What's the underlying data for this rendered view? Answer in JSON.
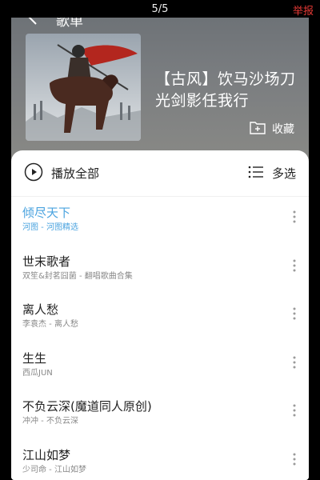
{
  "viewer": {
    "counter": "5/5",
    "report": "举报"
  },
  "header": {
    "title": "歌单",
    "back_icon": "back-arrow-icon"
  },
  "album": {
    "title_line1": "【古风】饮马沙场刀",
    "title_line2": "光剑影任我行",
    "collect_label": "收藏",
    "collect_icon": "add-folder-icon"
  },
  "toolbar": {
    "play_all_label": "播放全部",
    "play_icon": "play-circle-icon",
    "multi_select_label": "多选",
    "multi_select_icon": "list-icon"
  },
  "songs": [
    {
      "title": "倾尽天下",
      "subtitle": "河图 - 河图精选",
      "active": true
    },
    {
      "title": "世末歌者",
      "subtitle": "双笙&封茗囧菌 - 翻唱歌曲合集",
      "active": false
    },
    {
      "title": "离人愁",
      "subtitle": "李袁杰 - 离人愁",
      "active": false
    },
    {
      "title": "生生",
      "subtitle": "西瓜JUN",
      "active": false
    },
    {
      "title": "不负云深(魔道同人原创)",
      "subtitle": "冲冲 - 不负云深",
      "active": false
    },
    {
      "title": "江山如梦",
      "subtitle": "少司命 - 江山如梦",
      "active": false
    }
  ],
  "colors": {
    "accent": "#4aa3df",
    "report": "#e53935"
  }
}
